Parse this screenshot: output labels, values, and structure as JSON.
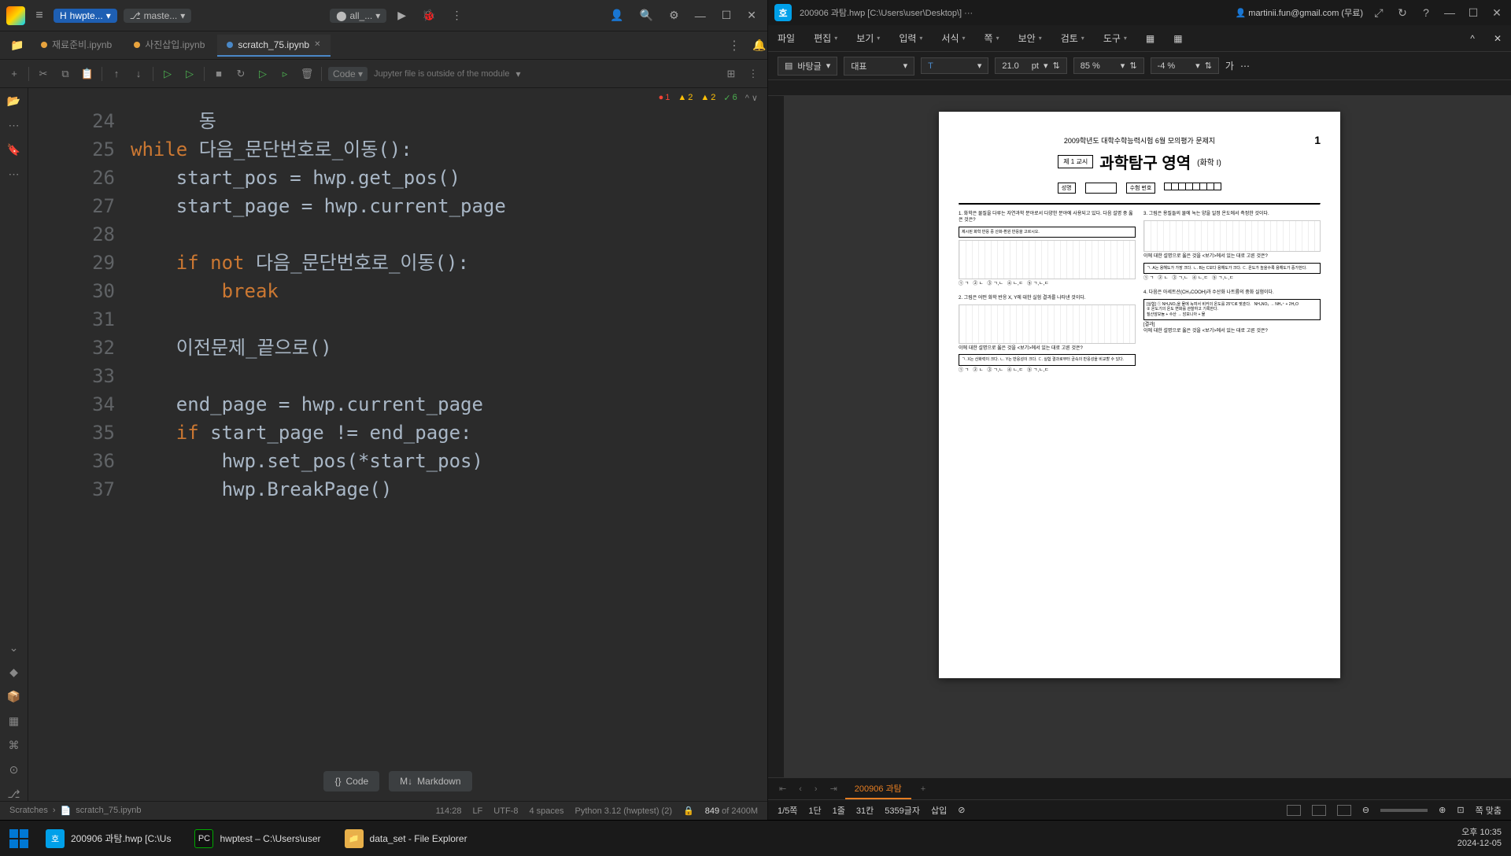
{
  "pycharm": {
    "topbar": {
      "project": "hwpte...",
      "branch": "maste...",
      "run_config": "all_..."
    },
    "tabs": [
      {
        "label": "재료준비.ipynb",
        "active": false
      },
      {
        "label": "사진삽입.ipynb",
        "active": false
      },
      {
        "label": "scratch_75.ipynb",
        "active": true
      }
    ],
    "toolbar": {
      "cell_type": "Code",
      "jupyter_msg": "Jupyter file is outside of the module"
    },
    "badges": {
      "errors": "1",
      "warnings": "2",
      "weak": "2",
      "ok": "6"
    },
    "code_lines": [
      {
        "n": "24",
        "html": "      <span class='fn'>동</span>"
      },
      {
        "n": "25",
        "html": "<span class='kw'>while</span> 다음_문단번호로_이동():"
      },
      {
        "n": "26",
        "html": "    start_pos = hwp.get_pos()"
      },
      {
        "n": "27",
        "html": "    start_page = hwp.current_page"
      },
      {
        "n": "28",
        "html": ""
      },
      {
        "n": "29",
        "html": "    <span class='kw'>if not</span> 다음_문단번호로_이동():"
      },
      {
        "n": "30",
        "html": "        <span class='kw'>break</span>"
      },
      {
        "n": "31",
        "html": ""
      },
      {
        "n": "32",
        "html": "    이전문제_끝으로()"
      },
      {
        "n": "33",
        "html": ""
      },
      {
        "n": "34",
        "html": "    end_page = hwp.current_page"
      },
      {
        "n": "35",
        "html": "    <span class='kw'>if</span> start_page != end_page:"
      },
      {
        "n": "36",
        "html": "        hwp.set_pos(*start_pos)"
      },
      {
        "n": "37",
        "html": "        hwp.BreakPage()"
      }
    ],
    "cell_buttons": {
      "code": "Code",
      "markdown": "Markdown"
    },
    "status": {
      "breadcrumb": [
        "Scratches",
        "scratch_75.ipynb"
      ],
      "pos": "114:28",
      "line_end": "LF",
      "encoding": "UTF-8",
      "indent": "4 spaces",
      "interpreter": "Python 3.12 (hwptest) (2)",
      "mem": "849",
      "mem_total": "of 2400M"
    }
  },
  "hancom": {
    "title": "200906 과탐.hwp [C:\\Users\\user\\Desktop\\] ···",
    "user": "martinii.fun@gmail.com (무료)",
    "menu": [
      "파일",
      "편집",
      "보기",
      "입력",
      "서식",
      "쪽",
      "보안",
      "검토",
      "도구"
    ],
    "toolbar": {
      "style": "바탕글",
      "para": "대표",
      "font_size": "21.0",
      "font_unit": "pt",
      "zoom": "85 %",
      "spacing": "-4 %",
      "align": "가"
    },
    "doc": {
      "header": "2009학년도 대학수학능력시험 6월 모의평가 문제지",
      "page_num": "1",
      "badge": "제 1 교시",
      "title": "과학탐구 영역",
      "subtitle": "(화학 I)",
      "name_label": "성명",
      "num_label": "수험 번호"
    },
    "doctab": "200906 과탐",
    "status": {
      "page": "1/5쪽",
      "dan": "1단",
      "line": "1줄",
      "col": "31칸",
      "chars": "5359글자",
      "mode": "삽입",
      "fit": "쪽 맞춤"
    }
  },
  "taskbar": {
    "items": [
      {
        "icon": "hwp",
        "label": "200906 과탐.hwp [C:\\Us"
      },
      {
        "icon": "pc",
        "label": "hwptest – C:\\Users\\user"
      },
      {
        "icon": "folder",
        "label": "data_set - File Explorer"
      }
    ],
    "time": "오후 10:35",
    "date": "2024-12-05"
  }
}
